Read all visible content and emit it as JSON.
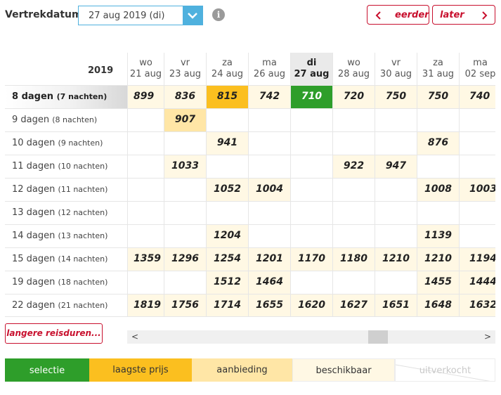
{
  "header": {
    "departure_label": "Vertrekdatum",
    "date_value": "27 aug 2019 (di)",
    "earlier_label": "eerder",
    "later_label": "later"
  },
  "grid": {
    "year": "2019",
    "dates": [
      {
        "dow": "wo",
        "date": "21 aug"
      },
      {
        "dow": "vr",
        "date": "23 aug"
      },
      {
        "dow": "za",
        "date": "24 aug"
      },
      {
        "dow": "ma",
        "date": "26 aug"
      },
      {
        "dow": "di",
        "date": "27 aug",
        "selected": true
      },
      {
        "dow": "wo",
        "date": "28 aug"
      },
      {
        "dow": "vr",
        "date": "30 aug"
      },
      {
        "dow": "za",
        "date": "31 aug"
      },
      {
        "dow": "ma",
        "date": "02 sep"
      }
    ],
    "rows": [
      {
        "days": "8 dagen",
        "nights": "(7 nachten)",
        "prices": [
          "899",
          "836",
          "815",
          "742",
          "710",
          "720",
          "750",
          "750",
          "740"
        ]
      },
      {
        "days": "9 dagen",
        "nights": "(8 nachten)",
        "prices": [
          "",
          "907",
          "",
          "",
          "",
          "",
          "",
          "",
          ""
        ]
      },
      {
        "days": "10 dagen",
        "nights": "(9 nachten)",
        "prices": [
          "",
          "",
          "941",
          "",
          "",
          "",
          "",
          "876",
          ""
        ]
      },
      {
        "days": "11 dagen",
        "nights": "(10 nachten)",
        "prices": [
          "",
          "1033",
          "",
          "",
          "",
          "922",
          "947",
          "",
          ""
        ]
      },
      {
        "days": "12 dagen",
        "nights": "(11 nachten)",
        "prices": [
          "",
          "",
          "1052",
          "1004",
          "",
          "",
          "",
          "1008",
          "1003"
        ]
      },
      {
        "days": "13 dagen",
        "nights": "(12 nachten)",
        "prices": [
          "",
          "",
          "",
          "",
          "",
          "",
          "",
          "",
          ""
        ]
      },
      {
        "days": "14 dagen",
        "nights": "(13 nachten)",
        "prices": [
          "",
          "",
          "1204",
          "",
          "",
          "",
          "",
          "1139",
          ""
        ]
      },
      {
        "days": "15 dagen",
        "nights": "(14 nachten)",
        "prices": [
          "1359",
          "1296",
          "1254",
          "1201",
          "1170",
          "1180",
          "1210",
          "1210",
          "1194"
        ]
      },
      {
        "days": "19 dagen",
        "nights": "(18 nachten)",
        "prices": [
          "",
          "",
          "1512",
          "1464",
          "",
          "",
          "",
          "1455",
          "1444"
        ]
      },
      {
        "days": "22 dagen",
        "nights": "(21 nachten)",
        "prices": [
          "1819",
          "1756",
          "1714",
          "1655",
          "1620",
          "1627",
          "1651",
          "1648",
          "1632"
        ]
      }
    ],
    "cell_states": [
      [
        "avail",
        "avail",
        "low",
        "avail",
        "sel",
        "avail",
        "avail",
        "avail",
        "avail"
      ],
      [
        "",
        "offer",
        "",
        "",
        "",
        "",
        "",
        "",
        ""
      ],
      [
        "",
        "",
        "avail",
        "",
        "",
        "",
        "",
        "avail",
        ""
      ],
      [
        "",
        "avail",
        "",
        "",
        "",
        "avail",
        "avail",
        "",
        ""
      ],
      [
        "",
        "",
        "avail",
        "avail",
        "",
        "",
        "",
        "avail",
        "avail"
      ],
      [
        "",
        "",
        "",
        "",
        "",
        "",
        "",
        "",
        ""
      ],
      [
        "",
        "",
        "avail",
        "",
        "",
        "",
        "",
        "avail",
        ""
      ],
      [
        "avail",
        "avail",
        "avail",
        "avail",
        "avail",
        "avail",
        "avail",
        "avail",
        "avail"
      ],
      [
        "",
        "",
        "avail",
        "avail",
        "",
        "",
        "",
        "avail",
        "avail"
      ],
      [
        "avail",
        "avail",
        "avail",
        "avail",
        "avail",
        "avail",
        "avail",
        "avail",
        "avail"
      ]
    ]
  },
  "more_button": "langere reisduren...",
  "legend": {
    "selection": "selectie",
    "lowest": "laagste prijs",
    "offer": "aanbieding",
    "available": "beschikbaar",
    "sold_out": "uitverkocht"
  },
  "colors": {
    "accent_red": "#c8102e",
    "select_blue": "#4fb1de",
    "selected_green": "#2e9e2a",
    "lowest_orange": "#fbbf1f",
    "offer_yellow": "#ffe6a6",
    "available_cream": "#fff8e4"
  }
}
